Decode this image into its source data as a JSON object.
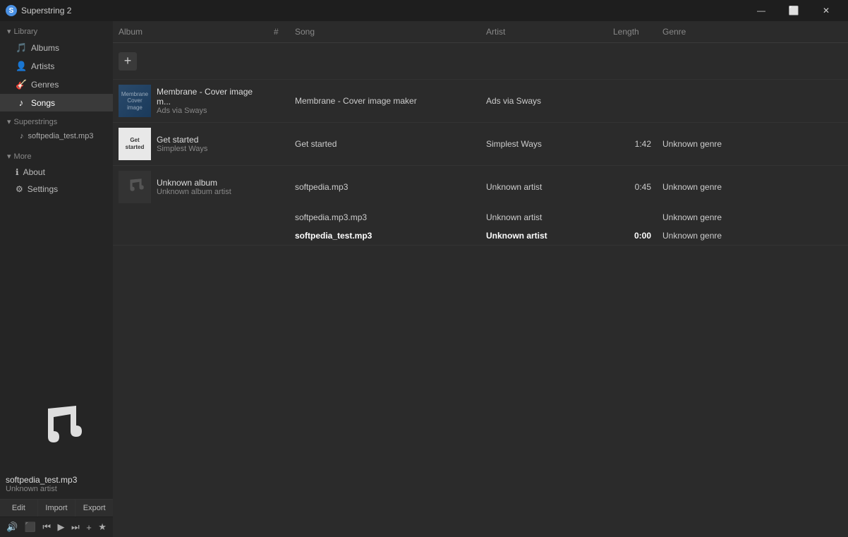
{
  "titlebar": {
    "app_name": "Superstring 2",
    "app_icon": "S",
    "controls": {
      "minimize": "—",
      "maximize": "⬜",
      "close": "✕"
    }
  },
  "sidebar": {
    "library_header": "Library",
    "library_items": [
      {
        "id": "albums",
        "label": "Albums",
        "icon": "🎵"
      },
      {
        "id": "artists",
        "label": "Artists",
        "icon": "👤"
      },
      {
        "id": "genres",
        "label": "Genres",
        "icon": "🎸"
      },
      {
        "id": "songs",
        "label": "Songs",
        "icon": "♪",
        "active": true
      }
    ],
    "superstrings_header": "Superstrings",
    "superstrings_items": [
      {
        "id": "softpedia_test",
        "label": "softpedia_test.mp3",
        "icon": "♪"
      }
    ],
    "more_header": "More",
    "more_items": [
      {
        "id": "about",
        "label": "About",
        "icon": "ℹ"
      },
      {
        "id": "settings",
        "label": "Settings",
        "icon": "⚙"
      }
    ]
  },
  "now_playing": {
    "track_name": "softpedia_test.mp3",
    "track_artist": "Unknown artist",
    "edit_label": "Edit",
    "import_label": "Import",
    "export_label": "Export"
  },
  "playback": {
    "volume_icon": "🔊",
    "screen_icon": "⬛",
    "prev_icon": "⏮",
    "play_icon": "▶",
    "next_icon": "⏭",
    "add_icon": "+",
    "star_icon": "★"
  },
  "table": {
    "columns": [
      "Album",
      "#",
      "Song",
      "Artist",
      "Length",
      "Genre"
    ]
  },
  "albums": [
    {
      "id": "add-row",
      "type": "add"
    },
    {
      "id": "membrane",
      "type": "album",
      "thumb_type": "membrane",
      "thumb_label": "Membrane",
      "name": "Membrane - Cover image m...",
      "sub": "Ads via Sways",
      "songs": [
        {
          "num": "",
          "title": "Membrane - Cover image maker",
          "artist": "Ads via Sways",
          "length": "",
          "genre": ""
        }
      ]
    },
    {
      "id": "get-started",
      "type": "album",
      "thumb_type": "get-started",
      "thumb_label": "Get started",
      "name": "Get started",
      "sub": "Simplest Ways",
      "songs": [
        {
          "num": "",
          "title": "Get started",
          "artist": "Simplest Ways",
          "length": "1:42",
          "genre": "Unknown genre"
        }
      ]
    },
    {
      "id": "unknown",
      "type": "album",
      "thumb_type": "unknown",
      "thumb_label": "♪",
      "name": "Unknown album",
      "sub": "Unknown album artist",
      "songs": [
        {
          "num": "",
          "title": "softpedia.mp3",
          "artist": "Unknown artist",
          "length": "0:45",
          "genre": "Unknown genre",
          "bold": false
        },
        {
          "num": "",
          "title": "softpedia.mp3.mp3",
          "artist": "Unknown artist",
          "length": "",
          "genre": "Unknown genre",
          "bold": false
        },
        {
          "num": "",
          "title": "softpedia_test.mp3",
          "artist": "Unknown artist",
          "length": "0:00",
          "genre": "Unknown genre",
          "bold": true
        }
      ]
    }
  ]
}
